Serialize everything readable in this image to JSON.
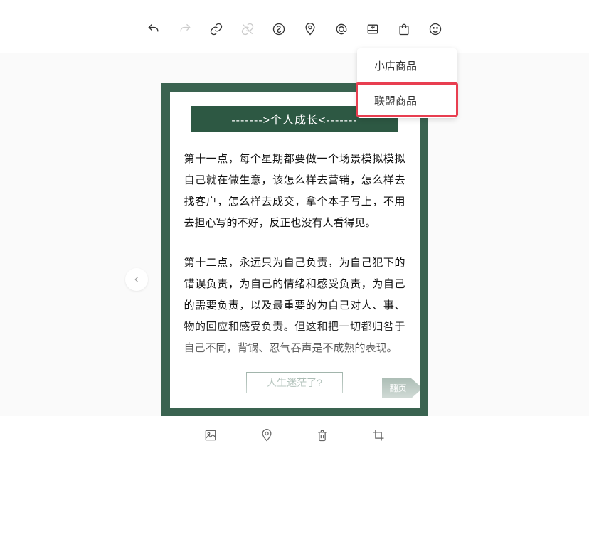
{
  "toolbar": {
    "undo": "undo",
    "redo": "redo",
    "link": "link",
    "unlink": "unlink",
    "miniprogram": "miniprogram",
    "location": "location",
    "mention": "mention",
    "inbox": "inbox",
    "shop": "shop",
    "emoji": "emoji"
  },
  "dropdown": {
    "item1": "小店商品",
    "item2": "联盟商品"
  },
  "card": {
    "title_prefix": "------->",
    "title_text": "个人成长",
    "title_suffix": "<-------",
    "para1": "第十一点，每个星期都要做一个场景模拟模拟自己就在做生意，该怎么样去营销，怎么样去找客户，怎么样去成交，拿个本子写上，不用去担心写的不好，反正也没有人看得见。",
    "para2": "第十二点，永远只为自己负责，为自己犯下的错误负责，为自己的情绪和感受负责，为自己的需要负责，以及最重要的为自己对人、事、物的回应和感受负责。但这和把一切都归咎于自己不同，背锅、忍气吞声是不成熟的表现。",
    "confused_label": "人生迷茫了?",
    "flip_label": "翻页"
  },
  "bottom": {
    "image": "image",
    "location": "location",
    "delete": "delete",
    "crop": "crop"
  }
}
